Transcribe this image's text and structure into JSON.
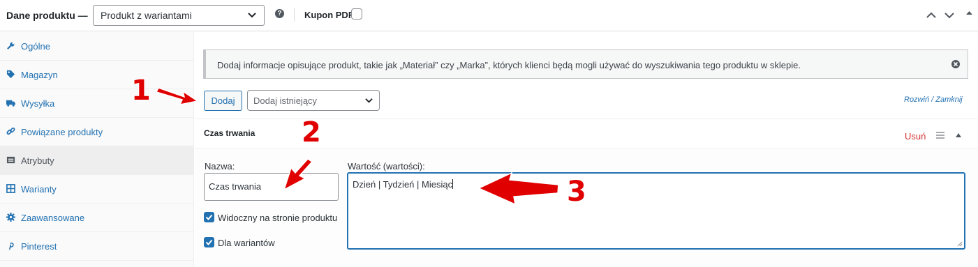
{
  "header": {
    "title": "Dane produktu —",
    "product_type": "Produkt z wariantami",
    "help_glyph": "?",
    "coupon_label": "Kupon PDF:"
  },
  "sidebar": {
    "items": [
      {
        "label": "Ogólne",
        "icon": "wrench-icon"
      },
      {
        "label": "Magazyn",
        "icon": "tag-icon"
      },
      {
        "label": "Wysyłka",
        "icon": "truck-icon"
      },
      {
        "label": "Powiązane produkty",
        "icon": "link-icon"
      },
      {
        "label": "Atrybuty",
        "icon": "list-icon"
      },
      {
        "label": "Warianty",
        "icon": "grid-icon"
      },
      {
        "label": "Zaawansowane",
        "icon": "gear-icon"
      },
      {
        "label": "Pinterest",
        "icon": "pinterest-icon"
      }
    ],
    "active": "Atrybuty"
  },
  "notice": {
    "text": "Dodaj informacje opisujące produkt, takie jak „Materiał” czy „Marka”, których klienci będą mogli używać do wyszukiwania tego produktu w sklepie."
  },
  "toolbar": {
    "add_label": "Dodaj",
    "existing_placeholder": "Dodaj istniejący",
    "expand_close": "Rozwiń / Zamknij"
  },
  "attribute": {
    "title": "Czas trwania",
    "remove_label": "Usuń",
    "name_label": "Nazwa:",
    "name_value": "Czas trwania",
    "values_label": "Wartość (wartości):",
    "values_value": "Dzień | Tydzień | Miesiąc",
    "visible_label": "Widoczny na stronie produktu",
    "variations_label": "Dla wariantów"
  },
  "annotations": {
    "labels": [
      "1",
      "2",
      "3"
    ],
    "color": "#e00000"
  },
  "colors": {
    "accent": "#2271b1",
    "danger": "#d63638"
  }
}
